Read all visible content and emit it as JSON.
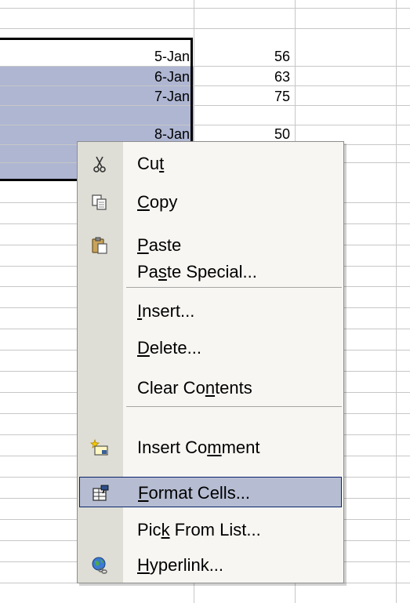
{
  "sheet": {
    "rows": [
      {
        "date": "5-Jan",
        "value": "56"
      },
      {
        "date": "6-Jan",
        "value": "63"
      },
      {
        "date": "7-Jan",
        "value": "75"
      },
      {
        "date": "8-Jan",
        "value": "50"
      }
    ]
  },
  "colors": {
    "selection": "#aeb6d2",
    "menu_background": "#f7f6f3",
    "menu_gutter": "#deded6",
    "highlight": "#b6bdd2",
    "highlight_border": "#0a246a"
  },
  "context_menu": {
    "items": [
      {
        "label": "Cut",
        "underline": "t",
        "icon": "scissors-icon"
      },
      {
        "label": "Copy",
        "underline": "C",
        "icon": "copy-icon"
      },
      {
        "label": "Paste",
        "underline": "P",
        "icon": "paste-icon"
      },
      {
        "label": "Paste Special...",
        "underline": "S",
        "icon": ""
      },
      {
        "label": "Insert...",
        "underline": "I",
        "icon": ""
      },
      {
        "label": "Delete...",
        "underline": "D",
        "icon": ""
      },
      {
        "label": "Clear Contents",
        "underline": "n",
        "icon": ""
      },
      {
        "label": "Insert Comment",
        "underline": "m",
        "icon": "insert-comment-icon"
      },
      {
        "label": "Format Cells...",
        "underline": "F",
        "icon": "format-cells-icon",
        "highlighted": true
      },
      {
        "label": "Pick From List...",
        "underline": "K",
        "icon": ""
      },
      {
        "label": "Hyperlink...",
        "underline": "H",
        "icon": "hyperlink-globe-icon"
      }
    ]
  }
}
